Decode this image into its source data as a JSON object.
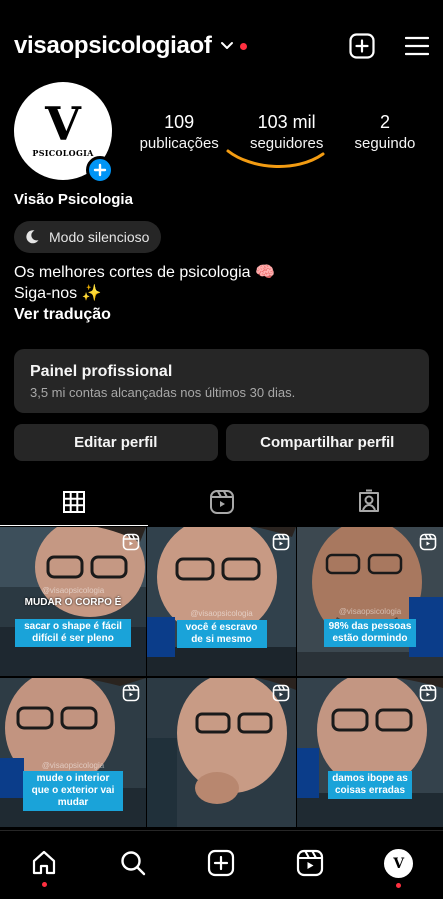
{
  "header": {
    "username": "visaopsicologiaof"
  },
  "profile": {
    "avatar_letter": "V",
    "avatar_sub": "PSICOLOGIA",
    "stats": [
      {
        "value": "109",
        "label": "publicações"
      },
      {
        "value": "103 mil",
        "label": "seguidores"
      },
      {
        "value": "2",
        "label": "seguindo"
      }
    ],
    "name": "Visão Psicologia",
    "mode": "Modo silencioso",
    "bio_line1": "Os melhores cortes de psicologia 🧠",
    "bio_line2": "Siga-nos ✨",
    "translate": "Ver tradução"
  },
  "panel": {
    "title": "Painel profissional",
    "subtitle": "3,5 mi contas alcançadas nos últimos 30 dias."
  },
  "actions": {
    "edit": "Editar perfil",
    "share": "Compartilhar perfil"
  },
  "grid": {
    "handle": "@visaopsicologia",
    "captions": [
      {
        "title": "MUDAR O CORPO É",
        "text": "sacar o shape é fácil difícil é ser pleno"
      },
      {
        "text": "você é escravo de si mesmo"
      },
      {
        "text": "98% das pessoas estão dormindo"
      },
      {
        "text": "mude o interior que o exterior vai mudar"
      },
      {
        "text": ""
      },
      {
        "text": "damos ibope as coisas erradas"
      }
    ]
  },
  "colors": {
    "accent": "#0095f6",
    "notif": "#ff3040",
    "underline": "#f39c12",
    "caption_bg": "#1aa3d9"
  }
}
